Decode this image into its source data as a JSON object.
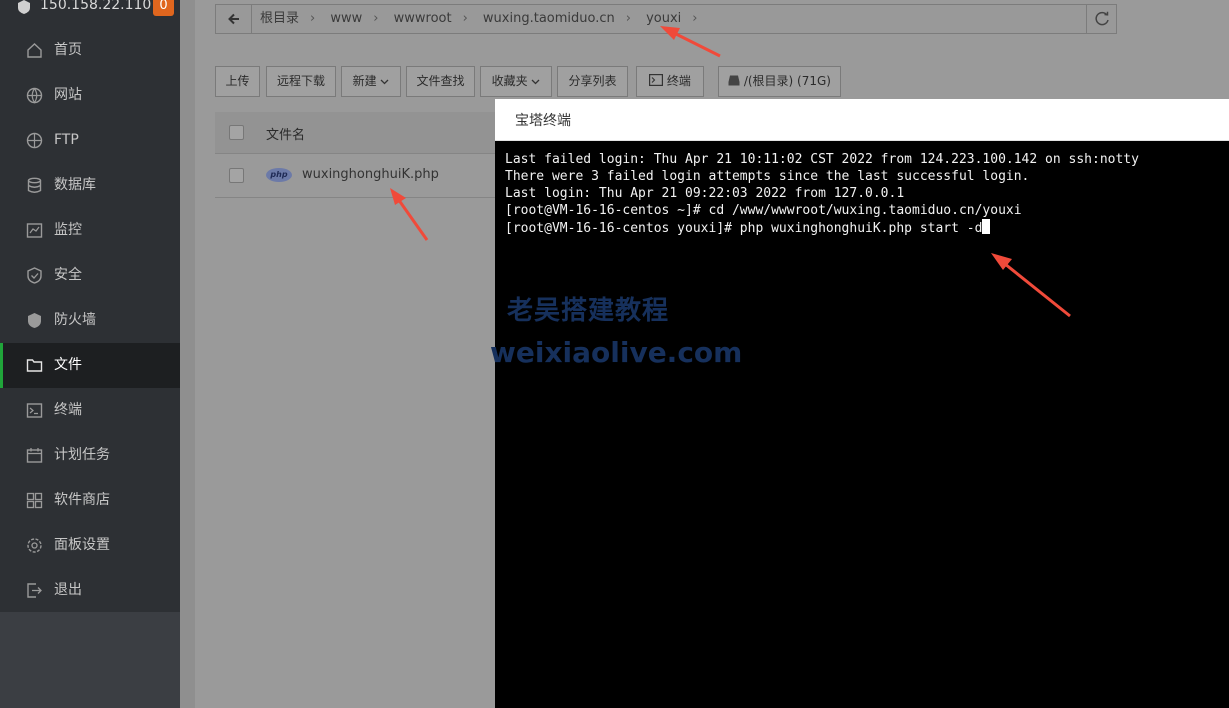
{
  "server": {
    "ip": "150.158.22.110",
    "alert_count": "0"
  },
  "sidebar": {
    "items": [
      {
        "label": "首页",
        "icon": "home-icon"
      },
      {
        "label": "网站",
        "icon": "globe-icon"
      },
      {
        "label": "FTP",
        "icon": "ftp-icon"
      },
      {
        "label": "数据库",
        "icon": "database-icon"
      },
      {
        "label": "监控",
        "icon": "monitor-icon"
      },
      {
        "label": "安全",
        "icon": "shield-icon"
      },
      {
        "label": "防火墙",
        "icon": "firewall-icon"
      },
      {
        "label": "文件",
        "icon": "folder-icon",
        "active": true
      },
      {
        "label": "终端",
        "icon": "terminal-icon"
      },
      {
        "label": "计划任务",
        "icon": "calendar-icon"
      },
      {
        "label": "软件商店",
        "icon": "apps-grid-icon"
      },
      {
        "label": "面板设置",
        "icon": "gear-icon"
      },
      {
        "label": "退出",
        "icon": "logout-icon"
      }
    ]
  },
  "path": {
    "crumbs": [
      "根目录",
      "www",
      "wwwroot",
      "wuxing.taomiduo.cn",
      "youxi"
    ]
  },
  "toolbar": {
    "upload": "上传",
    "remote_download": "远程下载",
    "new": "新建",
    "file_search": "文件查找",
    "favorites": "收藏夹",
    "share_list": "分享列表",
    "terminal": "终端",
    "disk": "/(根目录) (71G)"
  },
  "table": {
    "header_name": "文件名",
    "files": [
      {
        "name": "wuxinghonghuiK.php",
        "type_badge": "php"
      }
    ]
  },
  "terminal": {
    "title": "宝塔终端",
    "lines": [
      "Last failed login: Thu Apr 21 10:11:02 CST 2022 from 124.223.100.142 on ssh:notty",
      "There were 3 failed login attempts since the last successful login.",
      "Last login: Thu Apr 21 09:22:03 2022 from 127.0.0.1",
      "[root@VM-16-16-centos ~]# cd /www/wwwroot/wuxing.taomiduo.cn/youxi"
    ],
    "prompt_line": "[root@VM-16-16-centos youxi]# php wuxinghonghuiK.php start -d"
  },
  "watermark": {
    "cn": "老吴搭建教程",
    "en": "weixiaolive.com"
  },
  "colors": {
    "accent_green": "#20a53a",
    "badge_orange": "#e0661e",
    "annotation_red": "#f04a3a"
  }
}
